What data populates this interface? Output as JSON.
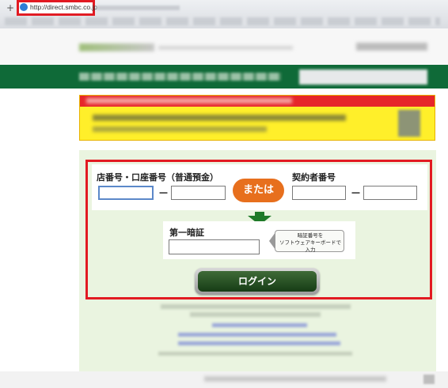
{
  "browser": {
    "url": "http://direct.smbc.co.jp",
    "new_tab_glyph": "+",
    "icons": {
      "browser": "ie-globe-icon"
    }
  },
  "login": {
    "branch_account_label": "店番号・口座番号（普通預金）",
    "or_label": "または",
    "contract_label": "契約者番号",
    "separator": "－",
    "pin_label": "第一暗証",
    "software_keyboard_line1": "暗証番号を",
    "software_keyboard_line2": "ソフトウェアキーボードで入力",
    "login_button": "ログイン"
  },
  "colors": {
    "header_green": "#0f6a38",
    "highlight_red": "#e21a22",
    "or_orange": "#e76f1d",
    "panel_green": "#eaf4e0",
    "login_button_green": "#1f4a1c",
    "notice_yellow": "#ffef2a"
  }
}
